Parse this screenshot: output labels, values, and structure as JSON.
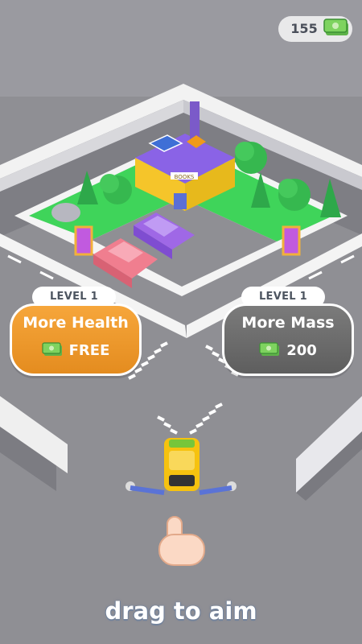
{
  "hud": {
    "currency_value": "155",
    "currency_icon": "cash-stack-icon"
  },
  "upgrades": [
    {
      "level": "LEVEL 1",
      "title": "More Health",
      "price": "FREE",
      "price_icon": "cash-icon",
      "color": "#F2A233"
    },
    {
      "level": "LEVEL 1",
      "title": "More Mass",
      "price": "200",
      "price_icon": "cash-icon",
      "color": "#6E6E6E"
    }
  ],
  "building": {
    "sign": "BOOKS"
  },
  "hint": {
    "text": "drag to aim",
    "icon": "pointing-hand-icon"
  },
  "colors": {
    "road": "#8F8F94",
    "grass": "#3FD45A",
    "wall": "#F2F2F2",
    "car_player": "#F6C20F",
    "car_pink": "#F07E8F",
    "car_purple": "#9F68E6"
  }
}
